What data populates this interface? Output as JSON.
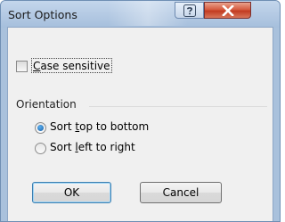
{
  "window": {
    "title": "Sort Options",
    "help_button": {
      "icon": "question-mark-icon"
    },
    "close_button": {
      "icon": "close-x-icon",
      "color": "#c7402a"
    }
  },
  "case_sensitive": {
    "label_pre": "",
    "label_mnemonic": "C",
    "label_post": "ase sensitive",
    "checked": false
  },
  "orientation": {
    "group_label": "Orientation",
    "options": [
      {
        "pre": "Sort ",
        "mnemonic": "t",
        "post": "op to bottom",
        "selected": true
      },
      {
        "pre": "Sort ",
        "mnemonic": "l",
        "post": "eft to right",
        "selected": false
      }
    ]
  },
  "buttons": {
    "ok_label": "OK",
    "cancel_label": "Cancel"
  },
  "colors": {
    "frame": "#a9c1dc",
    "client": "#f0f0f0",
    "default_button_border": "#3c7fb1"
  }
}
